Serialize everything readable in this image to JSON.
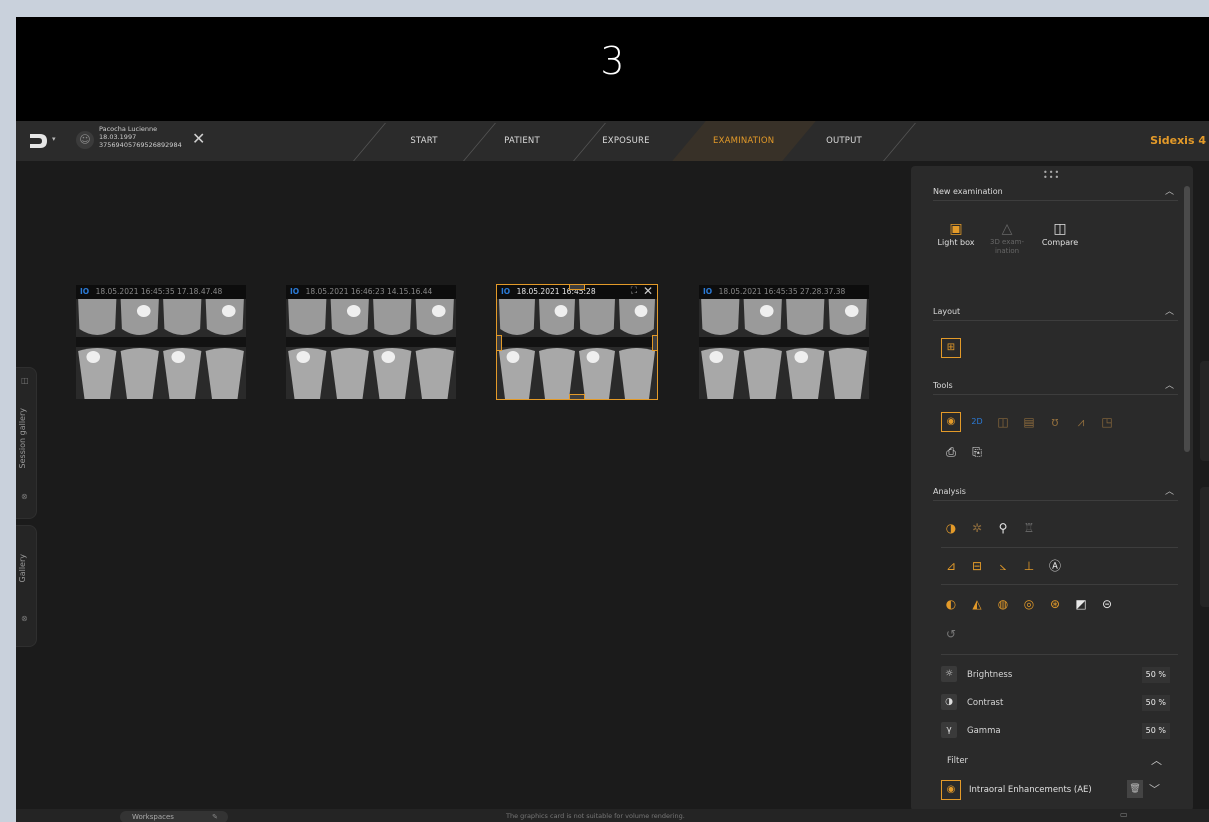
{
  "banner": {
    "number": "3"
  },
  "topbar": {
    "logo_icon": "sirona-logo",
    "patient": {
      "name": "Pacocha Lucienne",
      "dob": "18.03.1997",
      "id": "37569405769526892984"
    },
    "tabs": [
      {
        "label": "START",
        "active": false
      },
      {
        "label": "PATIENT",
        "active": false
      },
      {
        "label": "EXPOSURE",
        "active": false
      },
      {
        "label": "EXAMINATION",
        "active": true
      },
      {
        "label": "OUTPUT",
        "active": false
      }
    ],
    "product": "Sidexis 4"
  },
  "side_tabs": [
    {
      "label": "Session gallery",
      "icon": "camera-icon"
    },
    {
      "label": "Gallery",
      "icon": "camera-icon"
    }
  ],
  "images": [
    {
      "tag": "IO",
      "date": "18.05.2021",
      "time": "16:45:35",
      "extra": "17.18.47.48",
      "selected": false
    },
    {
      "tag": "IO",
      "date": "18.05.2021",
      "time": "16:46:23",
      "extra": "14.15.16.44",
      "selected": false
    },
    {
      "tag": "IO",
      "date": "18.05.2021",
      "time": "16:45:28",
      "extra": "",
      "selected": true
    },
    {
      "tag": "IO",
      "date": "18.05.2021",
      "time": "16:45:35",
      "extra": "27.28.37.38",
      "selected": false
    }
  ],
  "panel": {
    "new_examination": {
      "title": "New examination",
      "items": [
        {
          "label": "Light box",
          "icon": "lightbox-icon",
          "enabled": true
        },
        {
          "label": "3D exam-ination",
          "icon": "3d-exam-icon",
          "enabled": false
        },
        {
          "label": "Compare",
          "icon": "compare-icon",
          "enabled": true
        }
      ]
    },
    "layout": {
      "title": "Layout"
    },
    "tools": {
      "title": "Tools"
    },
    "analysis": {
      "title": "Analysis",
      "brightness": {
        "label": "Brightness",
        "value": "50",
        "unit": "%"
      },
      "contrast": {
        "label": "Contrast",
        "value": "50",
        "unit": "%"
      },
      "gamma": {
        "label": "Gamma",
        "value": "50",
        "unit": "%"
      },
      "filter_title": "Filter",
      "enhancement": "Intraoral Enhancements (AE)"
    }
  },
  "statusbar": {
    "workspace": "Workspaces",
    "message": "The graphics card is not suitable for volume rendering."
  },
  "colors": {
    "accent": "#e39a29",
    "background": "#1b1b1b",
    "panel": "#2a2a2a",
    "io_tag": "#2b7bd8"
  }
}
